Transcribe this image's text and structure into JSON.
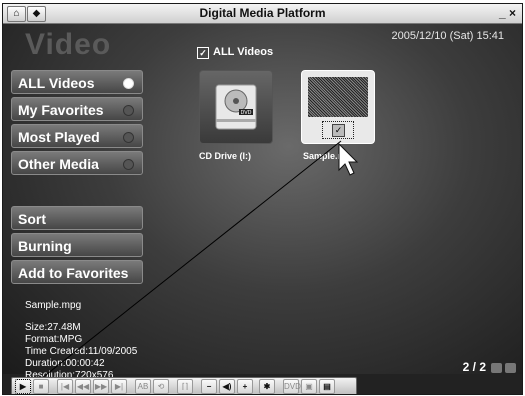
{
  "window": {
    "title": "Digital Media Platform",
    "home_icon": "⌂",
    "back_icon": "◆",
    "close_glyphs": "_ ×"
  },
  "header": {
    "section_title": "Video",
    "datetime": "2005/12/10 (Sat)  15:41"
  },
  "nav": {
    "items": [
      {
        "label": "ALL Videos",
        "active": true
      },
      {
        "label": "My Favorites",
        "active": false
      },
      {
        "label": "Most Played",
        "active": false
      },
      {
        "label": "Other Media",
        "active": false
      }
    ],
    "actions": [
      {
        "label": "Sort"
      },
      {
        "label": "Burning"
      },
      {
        "label": "Add to Favorites"
      }
    ]
  },
  "gallery": {
    "heading": "ALL Videos",
    "items": [
      {
        "label": "CD Drive  (I:)",
        "icon": "dvd-drive-icon"
      },
      {
        "label": "Sample.m",
        "icon": "video-thumbnail",
        "selected": true
      }
    ]
  },
  "details": {
    "filename": "Sample.mpg",
    "size": "Size:27.48M",
    "format": "Format:MPG",
    "time_created": "Time Created:11/09/2005",
    "duration": "Duration:00:00:42",
    "resolution": "Resolution:720x576"
  },
  "pagination": {
    "text": "2 / 2"
  },
  "controls": {
    "buttons": [
      "▶",
      "■",
      "|◀",
      "◀◀",
      "▶▶",
      "▶|",
      "AB",
      "⟲",
      "⌈⌉",
      "−",
      "◀)",
      "+",
      "✱",
      "DVD",
      "▣",
      "▤"
    ]
  },
  "colors": {
    "accent": "#ffffff",
    "panel": "#4a4a4a"
  }
}
